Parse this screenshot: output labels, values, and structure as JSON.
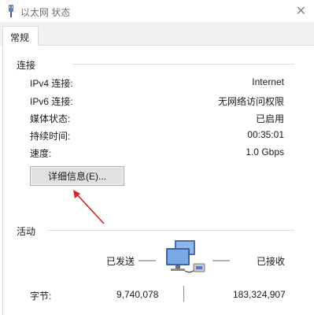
{
  "window": {
    "title": "以太网 状态",
    "close_glyph": "✕"
  },
  "tabs": [
    {
      "label": "常规",
      "active": true
    }
  ],
  "connection": {
    "group_label": "连接",
    "rows": [
      {
        "label": "IPv4 连接:",
        "value": "Internet"
      },
      {
        "label": "IPv6 连接:",
        "value": "无网络访问权限"
      },
      {
        "label": "媒体状态:",
        "value": "已启用"
      },
      {
        "label": "持续时间:",
        "value": "00:35:01"
      },
      {
        "label": "速度:",
        "value": "1.0 Gbps"
      }
    ],
    "details_button": "详细信息(E)..."
  },
  "activity": {
    "group_label": "活动",
    "sent_label": "已发送",
    "received_label": "已接收",
    "bytes_label": "字节:",
    "bytes_sent": "9,740,078",
    "bytes_received": "183,324,907"
  },
  "icons": {
    "title": "network-adapter-icon",
    "activity": "network-activity-icon",
    "annotation": "red-arrow"
  },
  "colors": {
    "annotation_arrow": "#e02020",
    "button_bg": "#e1e1e1"
  }
}
